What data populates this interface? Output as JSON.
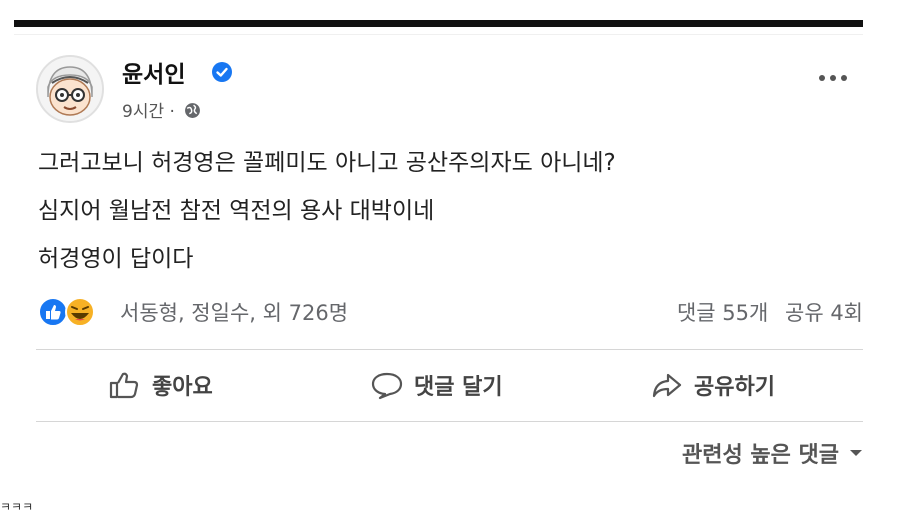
{
  "post": {
    "author": "윤서인",
    "time": "9시간",
    "meta_separator": "·",
    "lines": [
      "그러고보니 허경영은 꼴페미도 아니고 공산주의자도 아니네?",
      "심지어 월남전 참전 역전의 용사 대박이네",
      "허경영이 답이다"
    ]
  },
  "reactions": {
    "names": "서동형, 정일수, 외 726명",
    "comments": "댓글 55개",
    "shares": "공유 4회"
  },
  "actions": {
    "like": "좋아요",
    "comment": "댓글 달기",
    "share": "공유하기"
  },
  "sort": {
    "label": "관련성 높은 댓글"
  },
  "corner_text": "ㅋㅋㅋ",
  "colors": {
    "verified": "#1877f2",
    "like_reaction": "#1877f2",
    "haha_reaction": "#f7b125"
  }
}
